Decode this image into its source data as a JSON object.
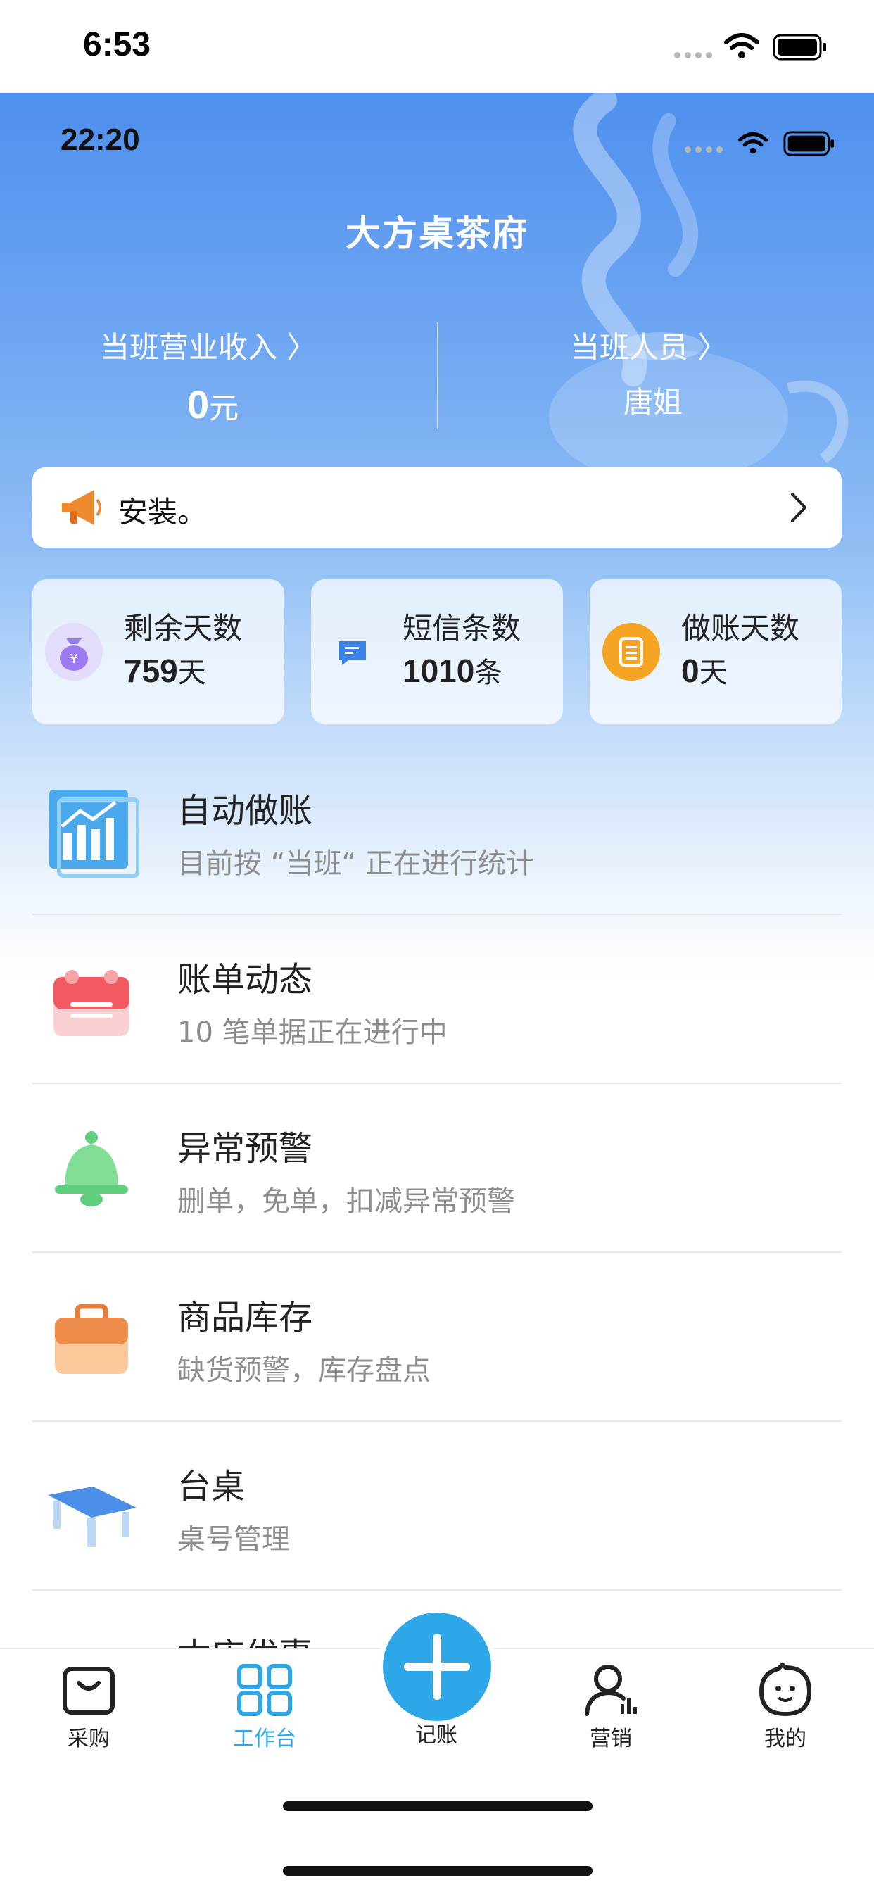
{
  "outer_status": {
    "time": "6:53"
  },
  "app_status": {
    "time": "22:20"
  },
  "store_name": "大方桌茶府",
  "shift_income": {
    "label": "当班营业收入 〉",
    "value": "0",
    "unit": "元"
  },
  "shift_staff": {
    "label": "当班人员 〉",
    "value": "唐姐"
  },
  "notice": {
    "text": "安装。"
  },
  "stats": [
    {
      "label": "剩余天数",
      "value": "759",
      "unit": "天",
      "icon": "money-bag-icon",
      "color": "#9b7cf0"
    },
    {
      "label": "短信条数",
      "value": "1010",
      "unit": "条",
      "icon": "message-icon",
      "color": "#3b82e8"
    },
    {
      "label": "做账天数",
      "value": "0",
      "unit": "天",
      "icon": "notepad-icon",
      "color": "#f5a523"
    }
  ],
  "features": [
    {
      "title": "自动做账",
      "subtitle": "目前按 “当班“ 正在进行统计",
      "icon": "bar-chart-icon"
    },
    {
      "title": "账单动态",
      "subtitle": "10 笔单据正在进行中",
      "icon": "calendar-icon"
    },
    {
      "title": "异常预警",
      "subtitle": "删单，免单，扣减异常预警",
      "icon": "bell-icon"
    },
    {
      "title": "商品库存",
      "subtitle": "缺货预警，库存盘点",
      "icon": "briefcase-icon"
    },
    {
      "title": "台桌",
      "subtitle": "桌号管理",
      "icon": "table-icon"
    },
    {
      "title": "本店优惠",
      "subtitle": "",
      "icon": "coupon-icon"
    }
  ],
  "tabbar": {
    "purchase": "采购",
    "workbench": "工作台",
    "record": "记账",
    "marketing": "营销",
    "mine": "我的",
    "active_color": "#2ea7e8"
  }
}
